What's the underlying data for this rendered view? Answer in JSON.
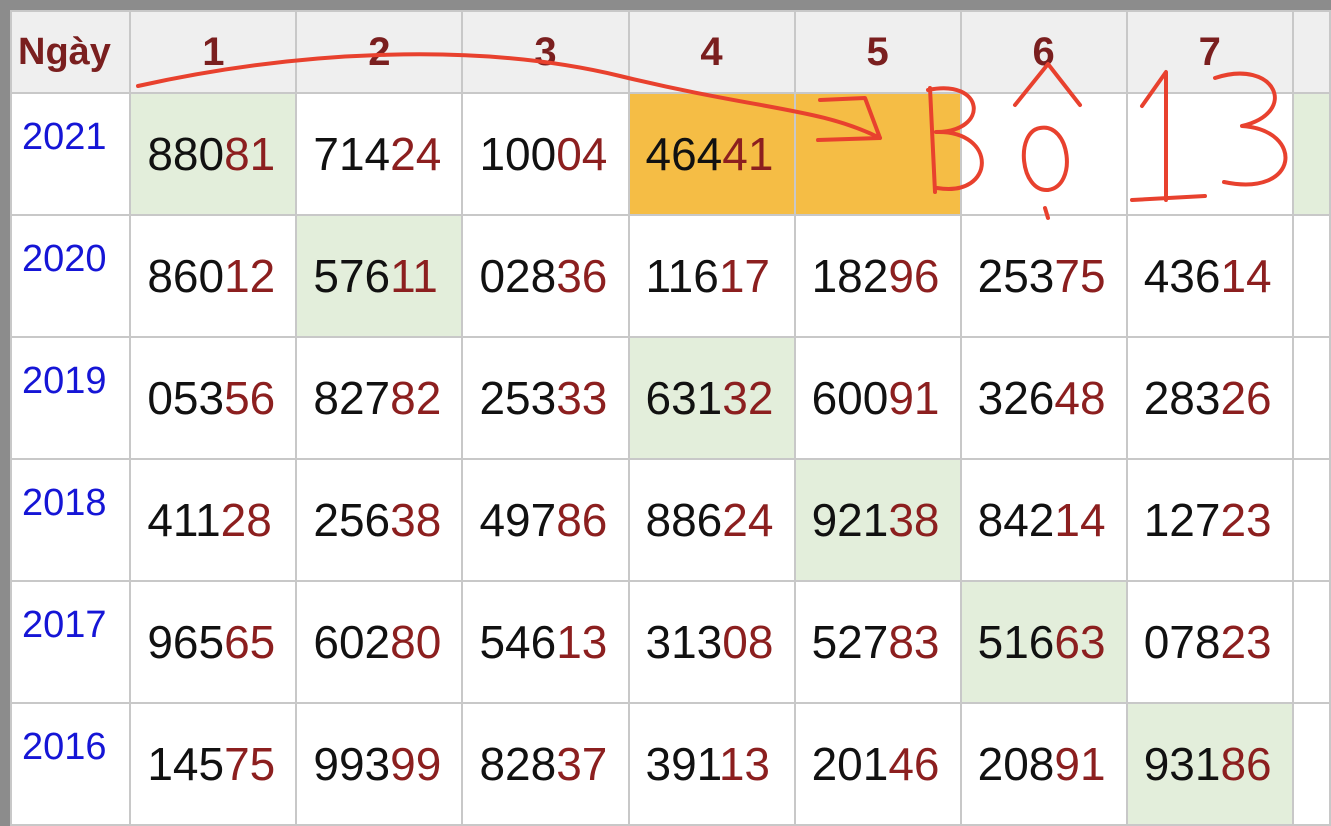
{
  "header": {
    "first_col": "Ngày",
    "columns": [
      "1",
      "2",
      "3",
      "4",
      "5",
      "6",
      "7"
    ]
  },
  "rows": [
    {
      "year": "2021",
      "cells": [
        {
          "head": "880",
          "tail": "81",
          "hl": "green"
        },
        {
          "head": "714",
          "tail": "24",
          "hl": ""
        },
        {
          "head": "100",
          "tail": "04",
          "hl": ""
        },
        {
          "head": "464",
          "tail": "41",
          "hl": "orange"
        },
        {
          "head": "",
          "tail": "",
          "hl": "orange"
        },
        {
          "head": "",
          "tail": "",
          "hl": ""
        },
        {
          "head": "",
          "tail": "",
          "hl": ""
        }
      ]
    },
    {
      "year": "2020",
      "cells": [
        {
          "head": "860",
          "tail": "12",
          "hl": ""
        },
        {
          "head": "576",
          "tail": "11",
          "hl": "green"
        },
        {
          "head": "028",
          "tail": "36",
          "hl": ""
        },
        {
          "head": "116",
          "tail": "17",
          "hl": ""
        },
        {
          "head": "182",
          "tail": "96",
          "hl": ""
        },
        {
          "head": "253",
          "tail": "75",
          "hl": ""
        },
        {
          "head": "436",
          "tail": "14",
          "hl": ""
        }
      ]
    },
    {
      "year": "2019",
      "cells": [
        {
          "head": "053",
          "tail": "56",
          "hl": ""
        },
        {
          "head": "827",
          "tail": "82",
          "hl": ""
        },
        {
          "head": "253",
          "tail": "33",
          "hl": ""
        },
        {
          "head": "631",
          "tail": "32",
          "hl": "green"
        },
        {
          "head": "600",
          "tail": "91",
          "hl": ""
        },
        {
          "head": "326",
          "tail": "48",
          "hl": ""
        },
        {
          "head": "283",
          "tail": "26",
          "hl": ""
        }
      ]
    },
    {
      "year": "2018",
      "cells": [
        {
          "head": "411",
          "tail": "28",
          "hl": ""
        },
        {
          "head": "256",
          "tail": "38",
          "hl": ""
        },
        {
          "head": "497",
          "tail": "86",
          "hl": ""
        },
        {
          "head": "886",
          "tail": "24",
          "hl": ""
        },
        {
          "head": "921",
          "tail": "38",
          "hl": "green"
        },
        {
          "head": "842",
          "tail": "14",
          "hl": ""
        },
        {
          "head": "127",
          "tail": "23",
          "hl": ""
        }
      ]
    },
    {
      "year": "2017",
      "cells": [
        {
          "head": "965",
          "tail": "65",
          "hl": ""
        },
        {
          "head": "602",
          "tail": "80",
          "hl": ""
        },
        {
          "head": "546",
          "tail": "13",
          "hl": ""
        },
        {
          "head": "313",
          "tail": "08",
          "hl": ""
        },
        {
          "head": "527",
          "tail": "83",
          "hl": ""
        },
        {
          "head": "516",
          "tail": "63",
          "hl": "green"
        },
        {
          "head": "078",
          "tail": "23",
          "hl": ""
        }
      ]
    },
    {
      "year": "2016",
      "cells": [
        {
          "head": "145",
          "tail": "75",
          "hl": ""
        },
        {
          "head": "993",
          "tail": "99",
          "hl": ""
        },
        {
          "head": "828",
          "tail": "37",
          "hl": ""
        },
        {
          "head": "391",
          "tail": "13",
          "hl": ""
        },
        {
          "head": "201",
          "tail": "46",
          "hl": ""
        },
        {
          "head": "208",
          "tail": "91",
          "hl": ""
        },
        {
          "head": "931",
          "tail": "86",
          "hl": "green"
        }
      ]
    }
  ],
  "annotation": {
    "text": "Bộ 13",
    "color": "#e8412e"
  }
}
